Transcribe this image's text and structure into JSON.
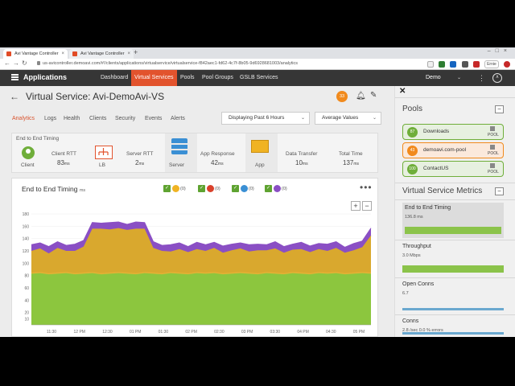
{
  "browser": {
    "tabs": [
      "Avi Vantage Controller",
      "Avi Vantage Controller"
    ],
    "url": "us-avicontroller.demoavi.com/#!/clients/applications/virtualservice/virtualservice-f842aec1-fd62-4c7f-8b05-9d6928681003/analytics",
    "profile": "Ernie"
  },
  "header": {
    "app_name": "Applications",
    "nav": [
      "Dashboard",
      "Virtual Services",
      "Pools",
      "Pool Groups",
      "GSLB Services"
    ],
    "tenant": "Demo"
  },
  "page": {
    "title": "Virtual Service:  Avi-DemoAvi-VS",
    "alert_count": "33",
    "tabs": [
      "Analytics",
      "Logs",
      "Health",
      "Clients",
      "Security",
      "Events",
      "Alerts"
    ],
    "time_range": "Displaying Past 6 Hours",
    "value_type": "Average Values"
  },
  "e2e": {
    "title": "End to End Timing",
    "nodes": [
      "Client",
      "LB",
      "Server",
      "App"
    ],
    "client_rtt_label": "Client RTT",
    "client_rtt_value": "83",
    "server_rtt_label": "Server RTT",
    "server_rtt_value": "2",
    "app_response_label": "App Response",
    "app_response_value": "42",
    "data_transfer_label": "Data Transfer",
    "data_transfer_value": "10",
    "total_time_label": "Total Time",
    "total_time_value": "137",
    "unit": "ms"
  },
  "chart_panel": {
    "title": "End to End Timing",
    "unit": "ms",
    "legend_counts": [
      "(0)",
      "(0)",
      "(0)",
      "(0)"
    ]
  },
  "chart_data": {
    "type": "area",
    "title": "End to End Timing",
    "ylim": [
      0,
      180
    ],
    "yticks": [
      10,
      20,
      40,
      60,
      80,
      100,
      120,
      140,
      160,
      180
    ],
    "xticks": [
      "11:30",
      "12 PM",
      "12:30",
      "01 PM",
      "01:30",
      "02 PM",
      "02:30",
      "03 PM",
      "03:30",
      "04 PM",
      "04:30",
      "05 PM"
    ],
    "series": [
      {
        "name": "Client RTT",
        "color": "#8cc63e",
        "values": [
          83,
          84,
          82,
          83,
          84,
          82,
          83,
          84,
          82,
          83,
          84,
          83,
          82,
          84,
          83,
          82,
          84,
          83,
          82,
          84,
          83,
          84,
          82,
          83,
          84,
          83,
          82,
          84,
          83,
          82,
          84,
          83,
          82,
          84,
          83,
          84,
          82,
          83,
          84,
          83
        ]
      },
      {
        "name": "Server RTT",
        "color": "#e4b235",
        "values": [
          2,
          2,
          2,
          2,
          2,
          2,
          2,
          2,
          2,
          2,
          2,
          2,
          2,
          2,
          2,
          2,
          2,
          2,
          2,
          2,
          2,
          2,
          2,
          2,
          2,
          2,
          2,
          2,
          2,
          2,
          2,
          2,
          2,
          2,
          2,
          2,
          2,
          2,
          2,
          2
        ]
      },
      {
        "name": "App Response",
        "color": "#d9a82e",
        "values": [
          35,
          38,
          32,
          40,
          34,
          36,
          42,
          70,
          72,
          70,
          71,
          69,
          72,
          70,
          40,
          36,
          33,
          38,
          34,
          37,
          35,
          39,
          33,
          36,
          38,
          34,
          37,
          35,
          39,
          33,
          36,
          38,
          34,
          37,
          35,
          39,
          33,
          36,
          40,
          60
        ]
      },
      {
        "name": "Data Transfer",
        "color": "#8a4fc4",
        "values": [
          10,
          9,
          11,
          10,
          9,
          11,
          10,
          10,
          9,
          11,
          10,
          9,
          11,
          10,
          10,
          9,
          11,
          10,
          9,
          11,
          10,
          9,
          11,
          10,
          9,
          11,
          10,
          9,
          11,
          10,
          9,
          11,
          10,
          9,
          11,
          10,
          9,
          11,
          10,
          12
        ]
      }
    ]
  },
  "right_panel": {
    "pools_title": "Pools",
    "pools": [
      {
        "score": "87",
        "name": "Downloads",
        "type": "POOL",
        "status": "good"
      },
      {
        "score": "43",
        "name": "demoavi.com-pool",
        "type": "POOL",
        "status": "warn"
      },
      {
        "score": "100",
        "name": "ContactUS",
        "type": "POOL",
        "status": "good"
      }
    ],
    "metrics_title": "Virtual Service Metrics",
    "metrics": [
      {
        "label": "End to End Timing",
        "value": "136.8 ms"
      },
      {
        "label": "Throughput",
        "value": "3.0 Mbps"
      },
      {
        "label": "Open Conns",
        "value": "6.7"
      },
      {
        "label": "Conns",
        "value": "2.8 /sec    0.0 % errors"
      }
    ]
  }
}
